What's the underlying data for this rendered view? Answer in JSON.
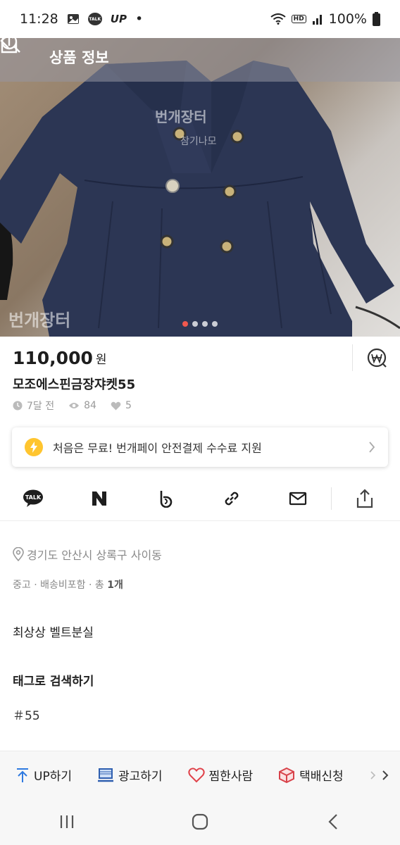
{
  "status_bar": {
    "time": "11:28",
    "notif_talk": "TALK",
    "notif_up": "UP",
    "dot": "•",
    "hd": "HD",
    "battery": "100%"
  },
  "header": {
    "title": "상품 정보"
  },
  "hero": {
    "watermark_main": "번개장터",
    "watermark_sub": "참기나모",
    "watermark_corner": "번개장터",
    "page_count": 4,
    "active_page": 1
  },
  "product": {
    "price": "110,000",
    "currency": "원",
    "title": "모조에스핀금장쟈켓55",
    "posted": "7달 전",
    "views": "84",
    "likes": "5"
  },
  "promo": {
    "text": "처음은 무료! 번개페이 안전결제 수수료 지원"
  },
  "share": {
    "talk_label": "TALK",
    "naver_label": "N",
    "band_label": "b"
  },
  "details": {
    "location": "경기도 안산시 상록구 사이동",
    "condition_prefix": "중고 · 배송비포함 · 총 ",
    "condition_count": "1개",
    "description": "최상상 벨트분실",
    "tag_heading": "태그로 검색하기",
    "tag": "＃55"
  },
  "actions": [
    {
      "label": "UP하기",
      "icon": "up-arrow-icon"
    },
    {
      "label": "광고하기",
      "icon": "laptop-icon"
    },
    {
      "label": "찜한사람",
      "icon": "heart-icon"
    },
    {
      "label": "택배신청",
      "icon": "box-icon"
    }
  ],
  "colors": {
    "accent": "#f0584e",
    "promo_bolt": "#ffc52f",
    "action_blue": "#2f7ae0",
    "navy_jacket": "#2c3654"
  }
}
